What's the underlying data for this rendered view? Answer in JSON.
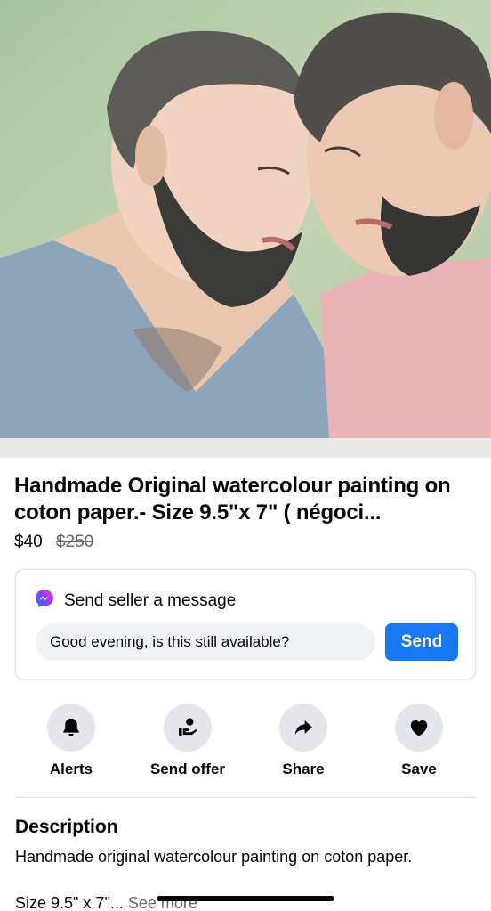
{
  "listing": {
    "image_alt": "watercolour painting of two bearded men",
    "title": "Handmade Original watercolour painting on coton paper.- Size 9.5\"x 7\" ( négoci...",
    "price": "$40",
    "original_price": "$250"
  },
  "message": {
    "icon": "messenger-icon",
    "heading": "Send seller a message",
    "input_value": "Good evening, is this still available?",
    "send_label": "Send"
  },
  "actions": [
    {
      "label": "Alerts",
      "icon": "bell-icon"
    },
    {
      "label": "Send offer",
      "icon": "offer-icon"
    },
    {
      "label": "Share",
      "icon": "share-icon"
    },
    {
      "label": "Save",
      "icon": "heart-icon"
    }
  ],
  "description": {
    "heading": "Description",
    "text": "Handmade original watercolour painting on coton paper.",
    "more_text": "Size 9.5\" x 7\"...",
    "see_more": "See more"
  },
  "colors": {
    "accent": "#1877f2",
    "secondary_text": "#65676b",
    "button_bg": "#e4e6eb"
  }
}
